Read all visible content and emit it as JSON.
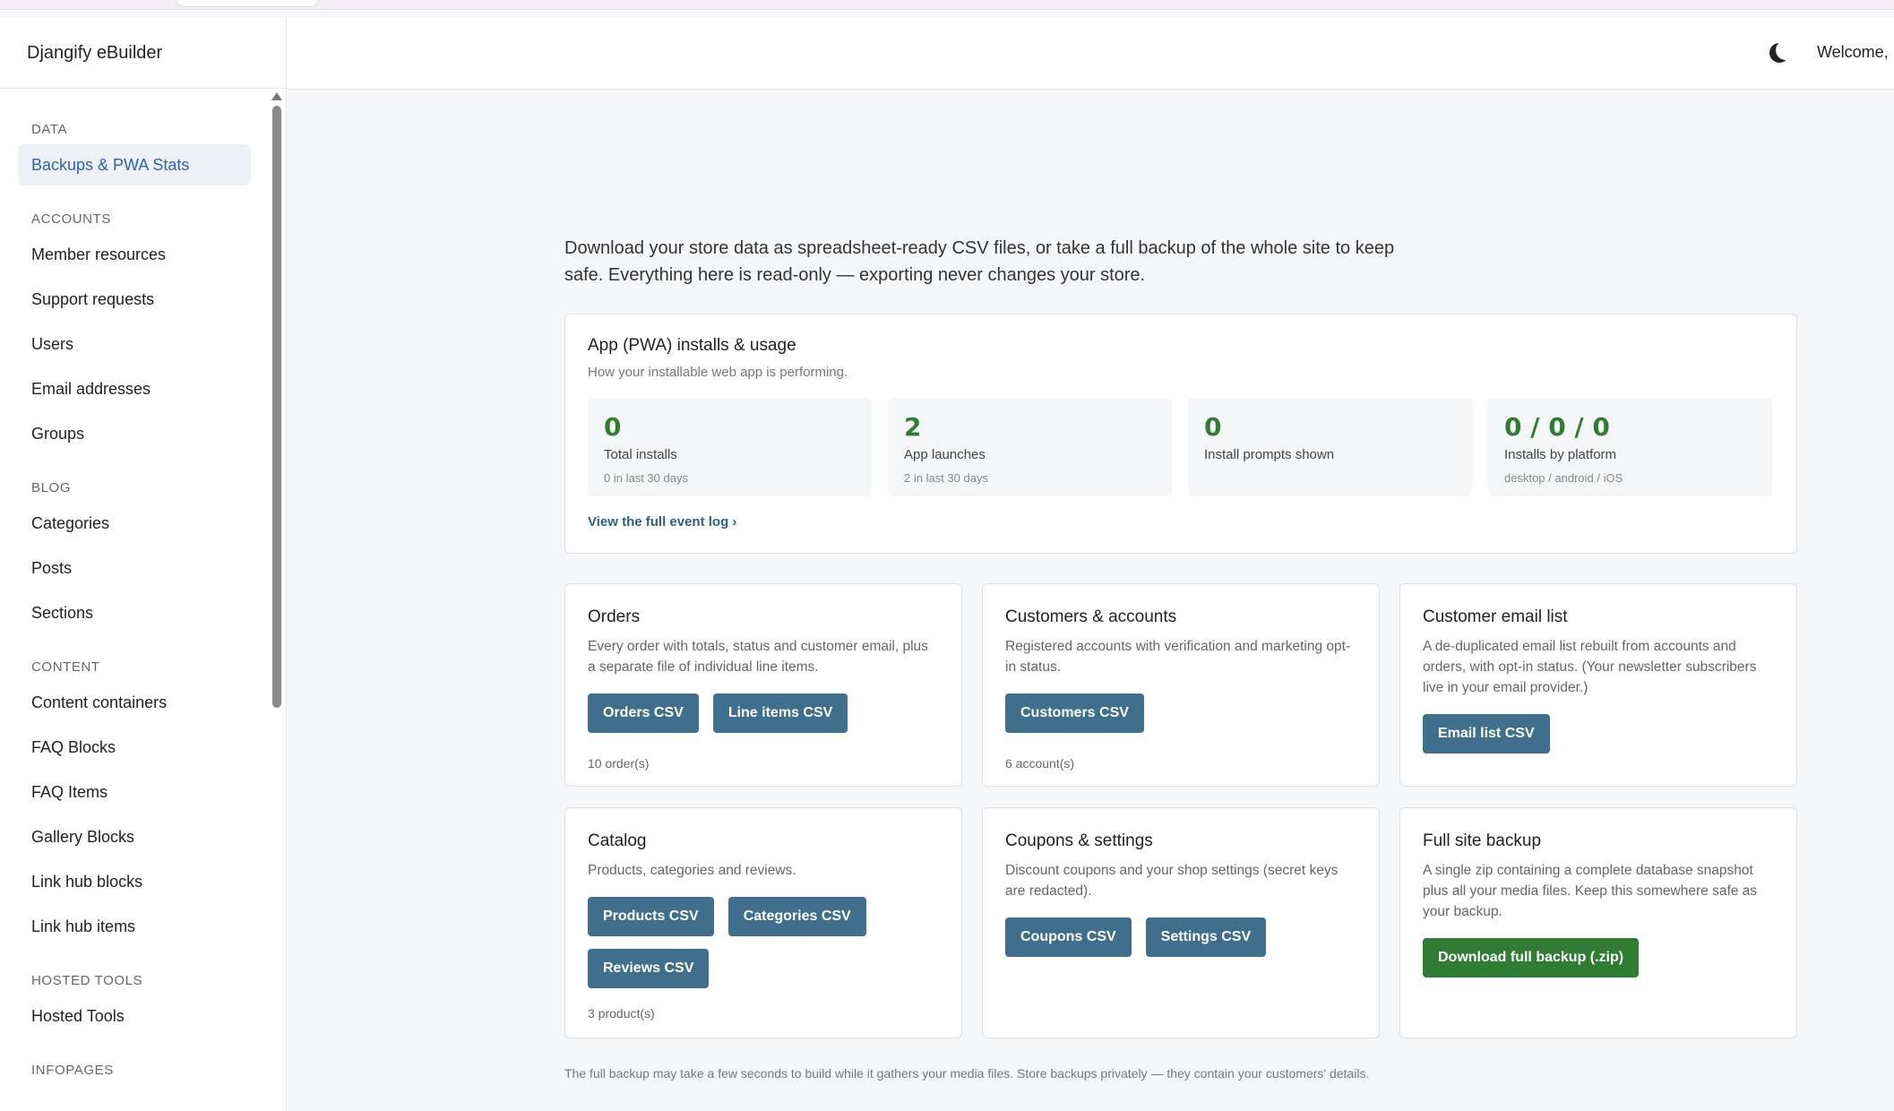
{
  "app": {
    "brand": "Djangify eBuilder",
    "welcome": "Welcome, I"
  },
  "icons": {
    "theme_toggle": "moon-icon"
  },
  "sidebar": {
    "sections": [
      {
        "title": "DATA",
        "items": [
          {
            "label": "Backups & PWA Stats",
            "active": true
          }
        ]
      },
      {
        "title": "ACCOUNTS",
        "items": [
          {
            "label": "Member resources"
          },
          {
            "label": "Support requests"
          },
          {
            "label": "Users"
          },
          {
            "label": "Email addresses"
          },
          {
            "label": "Groups"
          }
        ]
      },
      {
        "title": "BLOG",
        "items": [
          {
            "label": "Categories"
          },
          {
            "label": "Posts"
          },
          {
            "label": "Sections"
          }
        ]
      },
      {
        "title": "CONTENT",
        "items": [
          {
            "label": "Content containers"
          },
          {
            "label": "FAQ Blocks"
          },
          {
            "label": "FAQ Items"
          },
          {
            "label": "Gallery Blocks"
          },
          {
            "label": "Link hub blocks"
          },
          {
            "label": "Link hub items"
          }
        ]
      },
      {
        "title": "HOSTED TOOLS",
        "items": [
          {
            "label": "Hosted Tools"
          }
        ]
      },
      {
        "title": "INFOPAGES",
        "items": []
      }
    ]
  },
  "main": {
    "intro": "Download your store data as spreadsheet-ready CSV files, or take a full backup of the whole site to keep safe. Everything here is read-only — exporting never changes your store.",
    "pwa": {
      "title": "App (PWA) installs & usage",
      "subtitle": "How your installable web app is performing.",
      "stats": [
        {
          "value": "0",
          "label": "Total installs",
          "hint": "0 in last 30 days"
        },
        {
          "value": "2",
          "label": "App launches",
          "hint": "2 in last 30 days"
        },
        {
          "value": "0",
          "label": "Install prompts shown",
          "hint": ""
        },
        {
          "value": "0 / 0 / 0",
          "label": "Installs by platform",
          "hint": "desktop / android / iOS"
        }
      ],
      "event_link": "View the full event log ›"
    },
    "exports": [
      {
        "title": "Orders",
        "desc": "Every order with totals, status and customer email, plus a separate file of individual line items.",
        "buttons": [
          "Orders CSV",
          "Line items CSV"
        ],
        "count": "10 order(s)"
      },
      {
        "title": "Customers & accounts",
        "desc": "Registered accounts with verification and marketing opt-in status.",
        "buttons": [
          "Customers CSV"
        ],
        "count": "6 account(s)"
      },
      {
        "title": "Customer email list",
        "desc": "A de-duplicated email list rebuilt from accounts and orders, with opt-in status. (Your newsletter subscribers live in your email provider.)",
        "buttons": [
          "Email list CSV"
        ],
        "count": ""
      },
      {
        "title": "Catalog",
        "desc": "Products, categories and reviews.",
        "buttons": [
          "Products CSV",
          "Categories CSV",
          "Reviews CSV"
        ],
        "count": "3 product(s)"
      },
      {
        "title": "Coupons & settings",
        "desc": "Discount coupons and your shop settings (secret keys are redacted).",
        "buttons": [
          "Coupons CSV",
          "Settings CSV"
        ],
        "count": ""
      },
      {
        "title": "Full site backup",
        "desc": "A single zip containing a complete database snapshot plus all your media files. Keep this somewhere safe as your backup.",
        "buttons": [
          "Download full backup (.zip)"
        ],
        "count": "",
        "green": true
      }
    ],
    "footnote": "The full backup may take a few seconds to build while it gathers your media files. Store backups privately — they contain your customers' details."
  }
}
